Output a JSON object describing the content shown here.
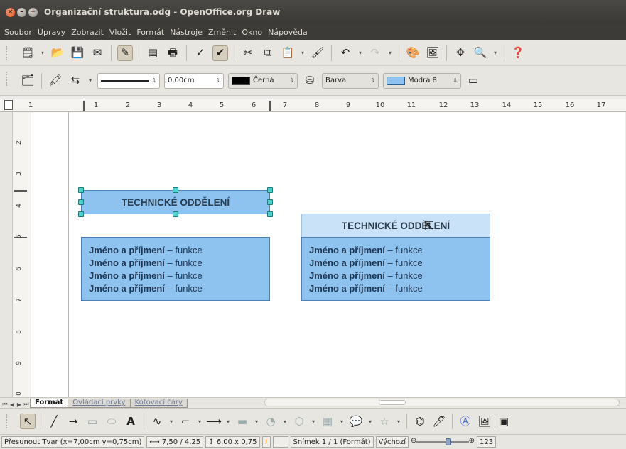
{
  "window": {
    "title": "Organizační struktura.odg - OpenOffice.org Draw",
    "close_glyph": "×",
    "min_glyph": "–",
    "max_glyph": "+"
  },
  "menu": [
    "Soubor",
    "Úpravy",
    "Zobrazit",
    "Vložit",
    "Formát",
    "Nástroje",
    "Změnit",
    "Okno",
    "Nápověda"
  ],
  "toolbar2": {
    "line_width": "0,00cm",
    "line_color": "Černá",
    "area_style": "Barva",
    "area_color": "Modrá 8",
    "line_color_hex": "#000000",
    "area_color_hex": "#8ec3f0"
  },
  "ruler": {
    "horizontal": [
      "1",
      "1",
      "2",
      "3",
      "4",
      "5",
      "6",
      "7",
      "8",
      "9",
      "10",
      "11",
      "12",
      "13",
      "14",
      "15",
      "16",
      "17"
    ],
    "vertical": [
      "2",
      "3",
      "4",
      "5",
      "6",
      "7",
      "8",
      "9",
      "0"
    ]
  },
  "canvas": {
    "title_box_1": "TECHNICKÉ ODDĚLENÍ",
    "title_box_2": "TECHNICKÉ ODDĚLENÍ",
    "list_box_1": [
      {
        "name": "Jméno a příjmení",
        "role": " – funkce"
      },
      {
        "name": "Jméno a příjmení",
        "role": " – funkce"
      },
      {
        "name": "Jméno a příjmení",
        "role": " – funkce"
      },
      {
        "name": "Jméno a příjmení",
        "role": " – funkce"
      }
    ],
    "list_box_2": [
      {
        "name": "Jméno a příjmení",
        "role": " – funkce"
      },
      {
        "name": "Jméno a příjmení",
        "role": " – funkce"
      },
      {
        "name": "Jméno a příjmení",
        "role": " – funkce"
      },
      {
        "name": "Jméno a příjmení",
        "role": " – funkce"
      }
    ],
    "box_color": "#8ec3f0",
    "border_color": "#4a7fb8"
  },
  "tabs": [
    "Formát",
    "Ovládací prvky",
    "Kótovací čáry"
  ],
  "status": {
    "action": "Přesunout Tvar (x=7,00cm y=0,75cm)",
    "position": "7,50 / 4,25",
    "size": "6,00 x 0,75",
    "slide": "Snímek 1 / 1 (Formát)",
    "layout": "Výchozí",
    "zoom": "123",
    "zoom_fraction": 0.62
  }
}
